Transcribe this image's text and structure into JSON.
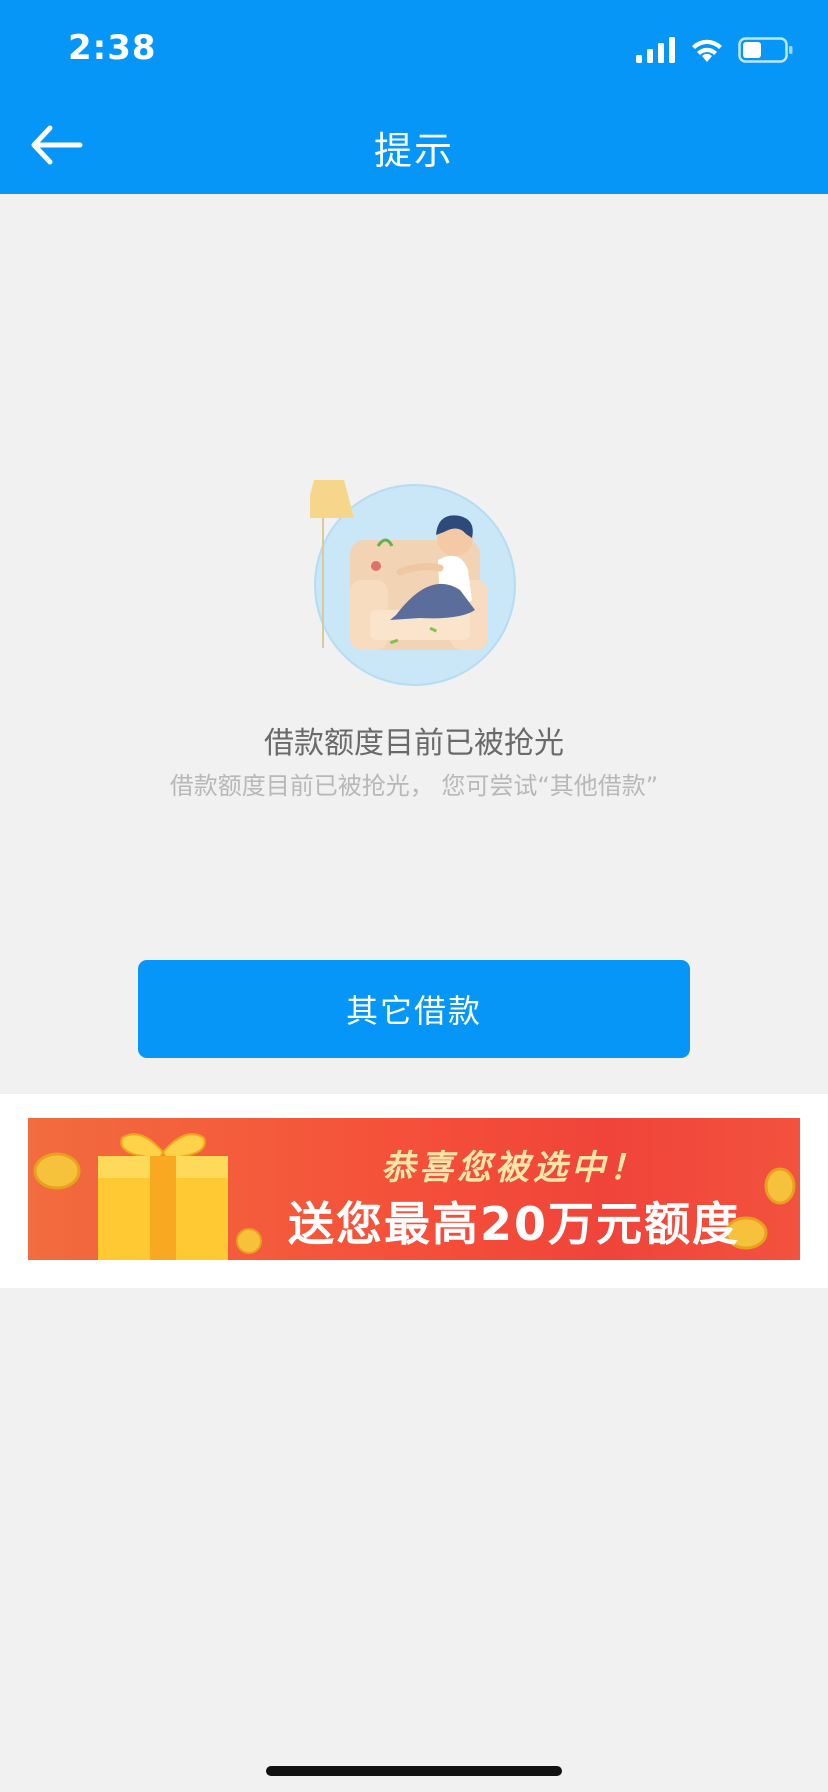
{
  "status_bar": {
    "time": "2:38"
  },
  "nav": {
    "title": "提示",
    "back_icon": "back-arrow-icon"
  },
  "empty_state": {
    "headline": "借款额度目前已被抢光",
    "subtext": "借款额度目前已被抢光， 您可尝试“其他借款”"
  },
  "actions": {
    "primary_label": "其它借款"
  },
  "banner": {
    "line1": "恭喜您被选中！",
    "line2": "送您最高20万元额度"
  },
  "colors": {
    "brand_blue": "#0596f7",
    "background": "#f1f1f1",
    "banner_red": "#f5523a",
    "banner_gold": "#fde6a8"
  }
}
